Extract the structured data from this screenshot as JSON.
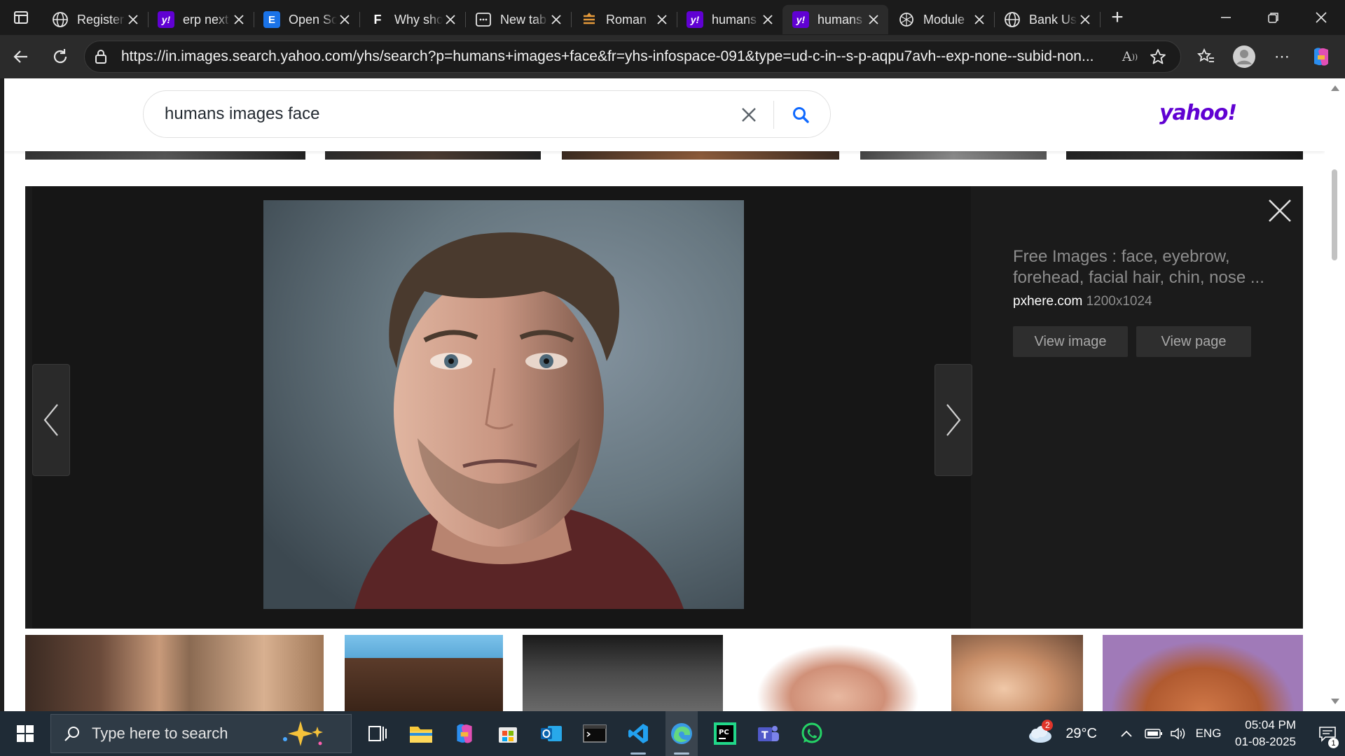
{
  "browser": {
    "tabs": [
      {
        "title": "Register",
        "favicon": "globe-icon",
        "active": false
      },
      {
        "title": "erp next",
        "favicon": "yahoo-icon",
        "active": false
      },
      {
        "title": "Open Sou",
        "favicon": "e-icon",
        "active": false
      },
      {
        "title": "Why sho",
        "favicon": "f-icon",
        "active": false
      },
      {
        "title": "New tab",
        "favicon": "newtab-icon",
        "active": false
      },
      {
        "title": "Roman",
        "favicon": "roman-icon",
        "active": false
      },
      {
        "title": "humans",
        "favicon": "yahoo-icon",
        "active": false
      },
      {
        "title": "humans",
        "favicon": "yahoo-icon",
        "active": true
      },
      {
        "title": "Module",
        "favicon": "openai-icon",
        "active": false
      },
      {
        "title": "Bank Us",
        "favicon": "globe-icon",
        "active": false
      }
    ],
    "url": "https://in.images.search.yahoo.com/yhs/search?p=humans+images+face&fr=yhs-infospace-091&type=ud-c-in--s-p-aqpu7avh--exp-none--subid-non..."
  },
  "search": {
    "query": "humans images face",
    "logo": "yahoo!"
  },
  "viewer": {
    "title_line1": "Free Images : face, eyebrow,",
    "title_line2": "forehead, facial hair, chin, nose ...",
    "domain": "pxhere.com",
    "dimensions": "1200x1024",
    "view_image_label": "View image",
    "view_page_label": "View page"
  },
  "taskbar": {
    "search_placeholder": "Type here to search",
    "weather_badge": "2",
    "temperature": "29°C",
    "language": "ENG",
    "time": "05:04 PM",
    "date": "01-08-2025",
    "notification_count": "1"
  },
  "colors": {
    "yahoo_purple": "#6001d2",
    "search_blue": "#0f69ff",
    "viewer_bg": "#1b1b1b"
  }
}
